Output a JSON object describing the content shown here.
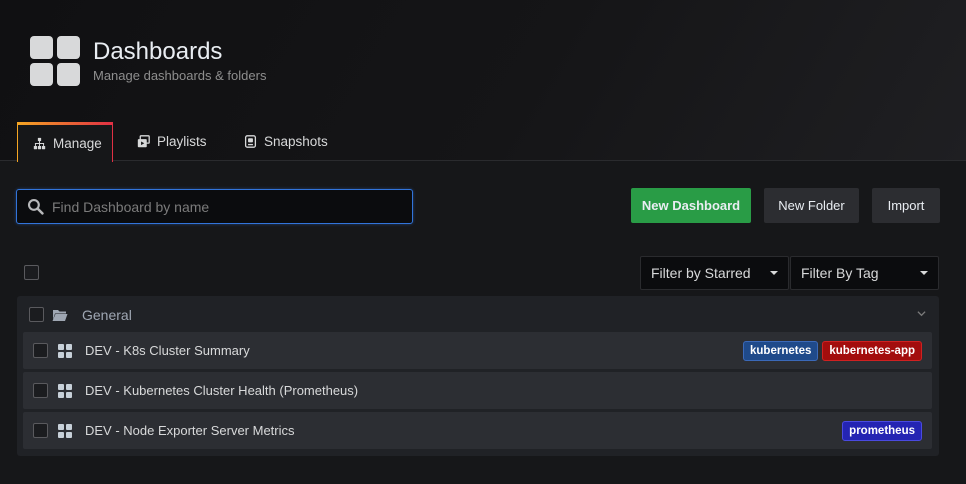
{
  "header": {
    "title": "Dashboards",
    "subtitle": "Manage dashboards & folders"
  },
  "tabs": [
    {
      "label": "Manage",
      "icon": "sitemap-icon",
      "active": true
    },
    {
      "label": "Playlists",
      "icon": "playlists-icon",
      "active": false
    },
    {
      "label": "Snapshots",
      "icon": "snapshots-icon",
      "active": false
    }
  ],
  "search": {
    "placeholder": "Find Dashboard by name",
    "value": ""
  },
  "actions": {
    "new_dashboard": "New Dashboard",
    "new_folder": "New Folder",
    "import": "Import"
  },
  "filters": {
    "starred": "Filter by Starred",
    "tag": "Filter By Tag"
  },
  "folder": {
    "name": "General"
  },
  "dashboards": [
    {
      "name": "DEV - K8s Cluster Summary",
      "tags": [
        {
          "label": "kubernetes",
          "color": "#1f4a8a",
          "border": "#3b69b8"
        },
        {
          "label": "kubernetes-app",
          "color": "#a30d0d",
          "border": "#d02121"
        }
      ]
    },
    {
      "name": "DEV - Kubernetes Cluster Health (Prometheus)",
      "tags": []
    },
    {
      "name": "DEV - Node Exporter Server Metrics",
      "tags": [
        {
          "label": "prometheus",
          "color": "#2424b3",
          "border": "#4a4ae0"
        }
      ]
    }
  ],
  "colors": {
    "primary_button": "#299c46",
    "search_focus_border": "#3274d9",
    "tab_accent_start": "#f5a623",
    "tab_accent_end": "#e02f44"
  }
}
